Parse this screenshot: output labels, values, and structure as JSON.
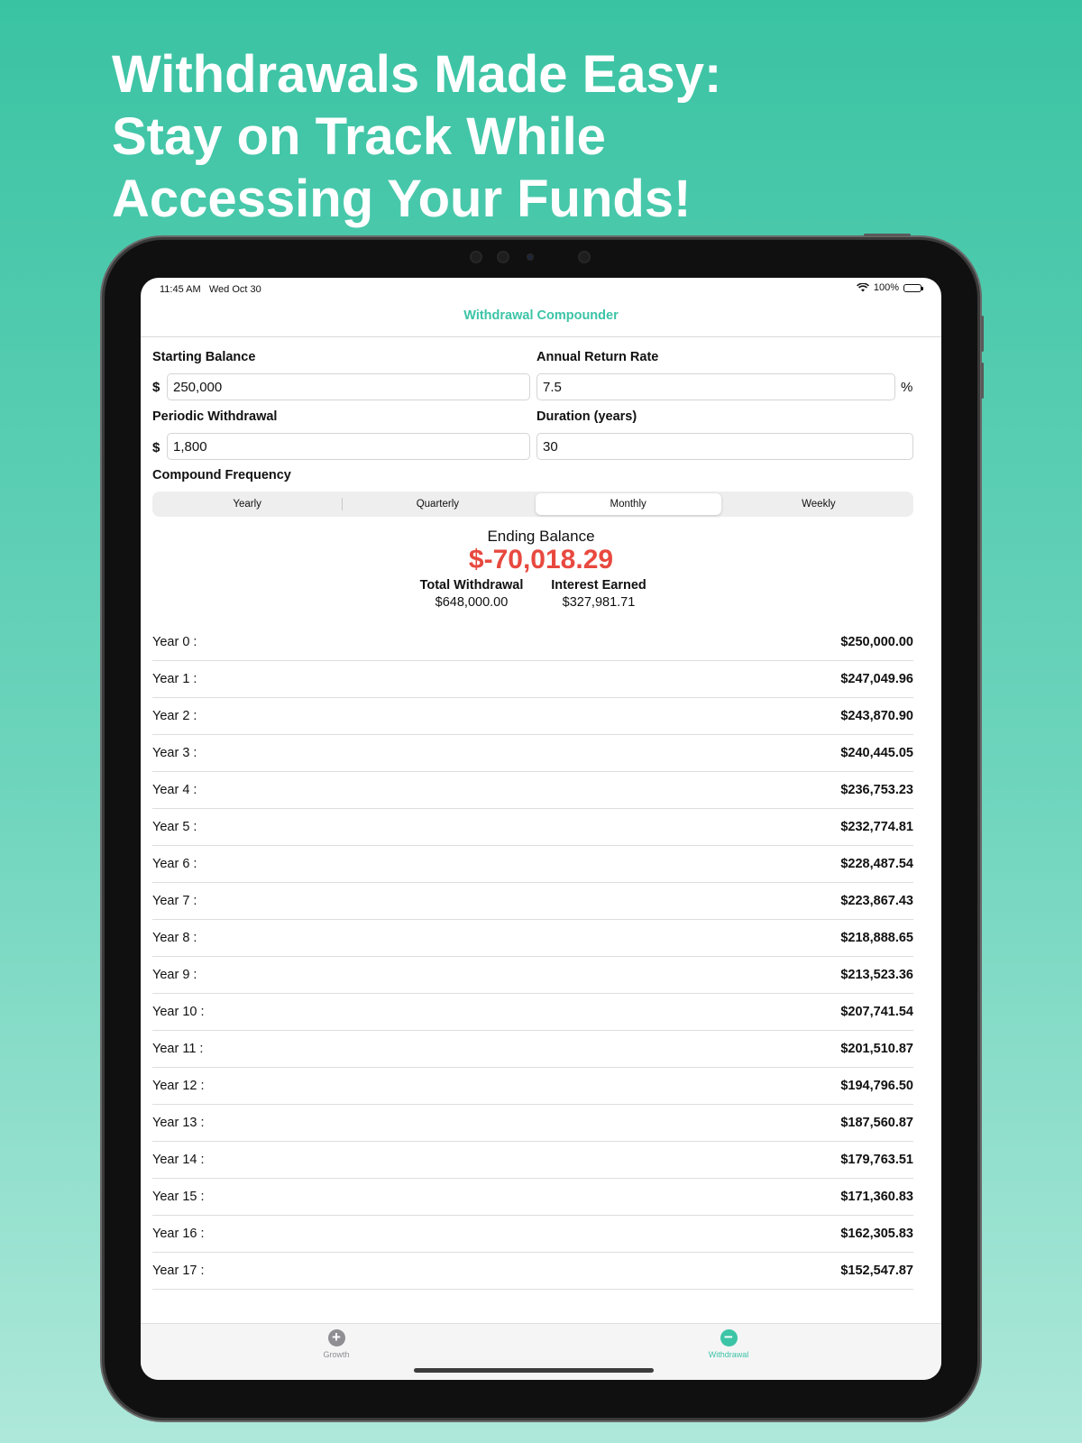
{
  "headline": {
    "line1": "Withdrawals Made Easy:",
    "line2": "Stay on Track While",
    "line3": "Accessing Your Funds!"
  },
  "status_bar": {
    "time": "11:45 AM",
    "date": "Wed Oct 30",
    "battery": "100%",
    "battery_level": 1.0
  },
  "nav": {
    "title": "Withdrawal Compounder"
  },
  "form": {
    "starting_balance": {
      "label": "Starting Balance",
      "prefix": "$",
      "value": "250,000"
    },
    "annual_return_rate": {
      "label": "Annual Return Rate",
      "suffix": "%",
      "value": "7.5"
    },
    "periodic_withdrawal": {
      "label": "Periodic Withdrawal",
      "prefix": "$",
      "value": "1,800"
    },
    "duration": {
      "label": "Duration (years)",
      "value": "30"
    },
    "compound_frequency": {
      "label": "Compound Frequency",
      "options": [
        "Yearly",
        "Quarterly",
        "Monthly",
        "Weekly"
      ],
      "selected": "Monthly"
    }
  },
  "summary": {
    "ending_balance_label": "Ending Balance",
    "ending_balance": "$-70,018.29",
    "total_withdrawal_label": "Total Withdrawal",
    "total_withdrawal": "$648,000.00",
    "interest_earned_label": "Interest Earned",
    "interest_earned": "$327,981.71"
  },
  "yearly_balances": [
    {
      "year": "Year 0 :",
      "amount": "$250,000.00"
    },
    {
      "year": "Year 1 :",
      "amount": "$247,049.96"
    },
    {
      "year": "Year 2 :",
      "amount": "$243,870.90"
    },
    {
      "year": "Year 3 :",
      "amount": "$240,445.05"
    },
    {
      "year": "Year 4 :",
      "amount": "$236,753.23"
    },
    {
      "year": "Year 5 :",
      "amount": "$232,774.81"
    },
    {
      "year": "Year 6 :",
      "amount": "$228,487.54"
    },
    {
      "year": "Year 7 :",
      "amount": "$223,867.43"
    },
    {
      "year": "Year 8 :",
      "amount": "$218,888.65"
    },
    {
      "year": "Year 9 :",
      "amount": "$213,523.36"
    },
    {
      "year": "Year 10 :",
      "amount": "$207,741.54"
    },
    {
      "year": "Year 11 :",
      "amount": "$201,510.87"
    },
    {
      "year": "Year 12 :",
      "amount": "$194,796.50"
    },
    {
      "year": "Year 13 :",
      "amount": "$187,560.87"
    },
    {
      "year": "Year 14 :",
      "amount": "$179,763.51"
    },
    {
      "year": "Year 15 :",
      "amount": "$171,360.83"
    },
    {
      "year": "Year 16 :",
      "amount": "$162,305.83"
    },
    {
      "year": "Year 17 :",
      "amount": "$152,547.87"
    }
  ],
  "tab_bar": {
    "growth": {
      "label": "Growth",
      "icon": "plus-circle-icon"
    },
    "withdrawal": {
      "label": "Withdrawal",
      "icon": "minus-circle-icon",
      "active": true
    }
  },
  "colors": {
    "accent": "#3cc4a6",
    "negative": "#e8493f",
    "inactive_tab": "#8e8e93"
  }
}
